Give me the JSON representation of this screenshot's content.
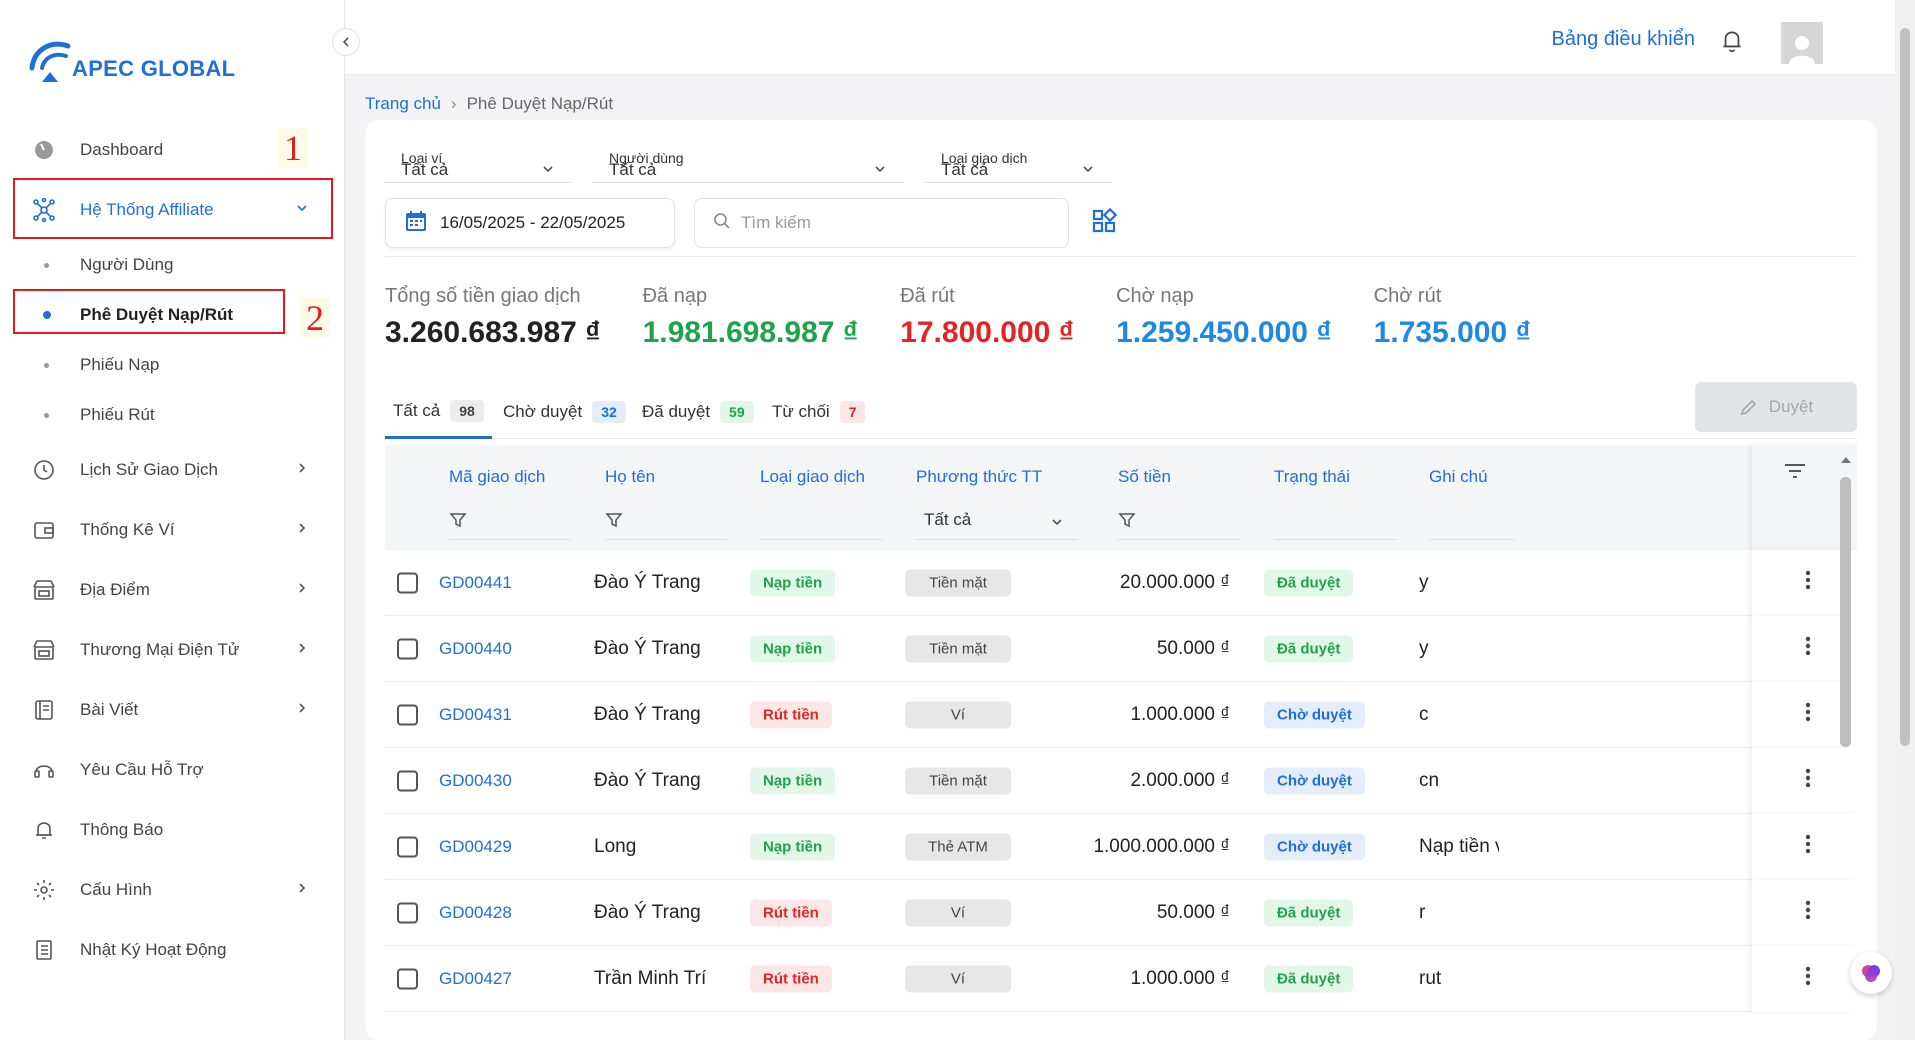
{
  "app": {
    "logo_text": "APEC GLOBAL"
  },
  "topbar": {
    "title": "Bảng điều khiển"
  },
  "sidebar": {
    "items": [
      {
        "label": "Dashboard"
      },
      {
        "label": "Hệ Thống Affiliate"
      },
      {
        "label": "Người Dùng"
      },
      {
        "label": "Phê Duyệt Nạp/Rút"
      },
      {
        "label": "Phiếu Nạp"
      },
      {
        "label": "Phiếu Rút"
      },
      {
        "label": "Lịch Sử Giao Dịch"
      },
      {
        "label": "Thống Kê Ví"
      },
      {
        "label": "Địa Điểm"
      },
      {
        "label": "Thương Mại Điện Tử"
      },
      {
        "label": "Bài Viết"
      },
      {
        "label": "Yêu Cầu Hỗ Trợ"
      },
      {
        "label": "Thông Báo"
      },
      {
        "label": "Cấu Hình"
      },
      {
        "label": "Nhật Ký Hoạt Động"
      }
    ],
    "annotations": [
      "1",
      "2"
    ]
  },
  "breadcrumb": {
    "home": "Trang chủ",
    "current": "Phê Duyệt Nạp/Rút"
  },
  "filters": {
    "wallet_type": {
      "label": "Loại ví",
      "value": "Tất cả"
    },
    "user": {
      "label": "Người dùng",
      "value": "Tất cả"
    },
    "tx_type": {
      "label": "Loại giao dịch",
      "value": "Tất cả"
    },
    "date_range": "16/05/2025 - 22/05/2025",
    "search_placeholder": "Tìm kiếm"
  },
  "stats": [
    {
      "label": "Tổng số tiền giao dịch",
      "value": "3.260.683.987 ₫",
      "color": "#222222"
    },
    {
      "label": "Đã nạp",
      "value": "1.981.698.987 ₫",
      "color": "#1fa34a"
    },
    {
      "label": "Đã rút",
      "value": "17.800.000 ₫",
      "color": "#e12525"
    },
    {
      "label": "Chờ nạp",
      "value": "1.259.450.000 ₫",
      "color": "#1e88e5"
    },
    {
      "label": "Chờ rút",
      "value": "1.735.000 ₫",
      "color": "#1e88e5"
    }
  ],
  "tabs": [
    {
      "label": "Tất cả",
      "count": "98"
    },
    {
      "label": "Chờ duyệt",
      "count": "32"
    },
    {
      "label": "Đã duyệt",
      "count": "59"
    },
    {
      "label": "Từ chối",
      "count": "7"
    }
  ],
  "approve_button": "Duyệt",
  "table": {
    "columns": [
      "Mã giao dịch",
      "Họ tên",
      "Loại giao dịch",
      "Phương thức TT",
      "Số tiền",
      "Trạng thái",
      "Ghi chú"
    ],
    "method_filter": "Tất cả",
    "rows": [
      {
        "code": "GD00441",
        "name": "Đào Ý Trang",
        "type": "Nạp tiền",
        "method": "Tiền mặt",
        "amount": "20.000.000 ₫",
        "status": "Đã duyệt",
        "note": "y"
      },
      {
        "code": "GD00440",
        "name": "Đào Ý Trang",
        "type": "Nạp tiền",
        "method": "Tiền mặt",
        "amount": "50.000 ₫",
        "status": "Đã duyệt",
        "note": "y"
      },
      {
        "code": "GD00431",
        "name": "Đào Ý Trang",
        "type": "Rút tiền",
        "method": "Ví",
        "amount": "1.000.000 ₫",
        "status": "Chờ duyệt",
        "note": "c"
      },
      {
        "code": "GD00430",
        "name": "Đào Ý Trang",
        "type": "Nạp tiền",
        "method": "Tiền mặt",
        "amount": "2.000.000 ₫",
        "status": "Chờ duyệt",
        "note": "cn"
      },
      {
        "code": "GD00429",
        "name": "Long",
        "type": "Nạp tiền",
        "method": "Thẻ ATM",
        "amount": "1.000.000.000 ₫",
        "status": "Chờ duyệt",
        "note": "Nạp tiền và"
      },
      {
        "code": "GD00428",
        "name": "Đào Ý Trang",
        "type": "Rút tiền",
        "method": "Ví",
        "amount": "50.000 ₫",
        "status": "Đã duyệt",
        "note": "r"
      },
      {
        "code": "GD00427",
        "name": "Trần Minh Trí",
        "type": "Rút tiền",
        "method": "Ví",
        "amount": "1.000.000 ₫",
        "status": "Đã duyệt",
        "note": "rut"
      }
    ]
  }
}
